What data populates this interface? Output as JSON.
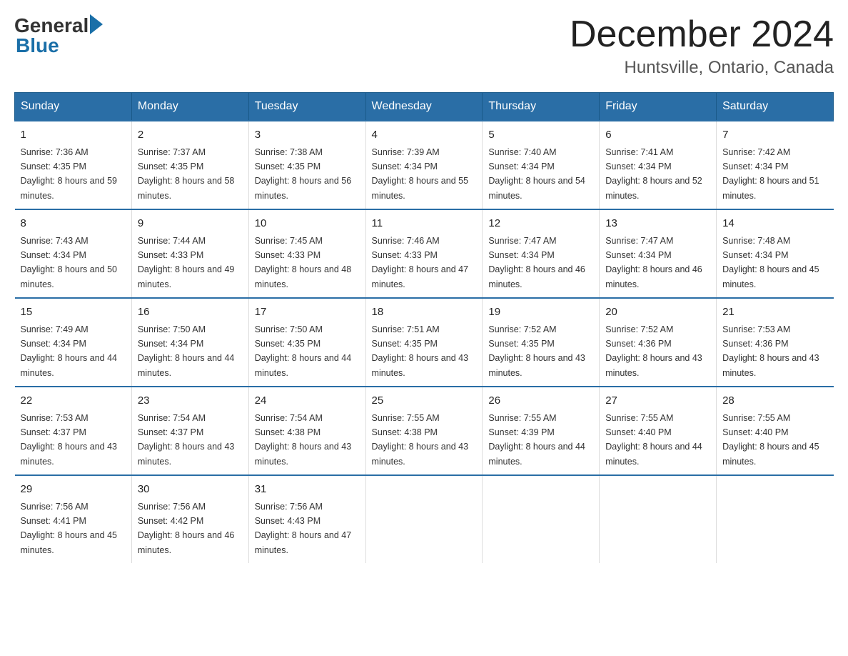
{
  "header": {
    "logo_general": "General",
    "logo_blue": "Blue",
    "title": "December 2024",
    "location": "Huntsville, Ontario, Canada"
  },
  "days_of_week": [
    "Sunday",
    "Monday",
    "Tuesday",
    "Wednesday",
    "Thursday",
    "Friday",
    "Saturday"
  ],
  "weeks": [
    [
      {
        "day": "1",
        "sunrise": "7:36 AM",
        "sunset": "4:35 PM",
        "daylight": "8 hours and 59 minutes."
      },
      {
        "day": "2",
        "sunrise": "7:37 AM",
        "sunset": "4:35 PM",
        "daylight": "8 hours and 58 minutes."
      },
      {
        "day": "3",
        "sunrise": "7:38 AM",
        "sunset": "4:35 PM",
        "daylight": "8 hours and 56 minutes."
      },
      {
        "day": "4",
        "sunrise": "7:39 AM",
        "sunset": "4:34 PM",
        "daylight": "8 hours and 55 minutes."
      },
      {
        "day": "5",
        "sunrise": "7:40 AM",
        "sunset": "4:34 PM",
        "daylight": "8 hours and 54 minutes."
      },
      {
        "day": "6",
        "sunrise": "7:41 AM",
        "sunset": "4:34 PM",
        "daylight": "8 hours and 52 minutes."
      },
      {
        "day": "7",
        "sunrise": "7:42 AM",
        "sunset": "4:34 PM",
        "daylight": "8 hours and 51 minutes."
      }
    ],
    [
      {
        "day": "8",
        "sunrise": "7:43 AM",
        "sunset": "4:34 PM",
        "daylight": "8 hours and 50 minutes."
      },
      {
        "day": "9",
        "sunrise": "7:44 AM",
        "sunset": "4:33 PM",
        "daylight": "8 hours and 49 minutes."
      },
      {
        "day": "10",
        "sunrise": "7:45 AM",
        "sunset": "4:33 PM",
        "daylight": "8 hours and 48 minutes."
      },
      {
        "day": "11",
        "sunrise": "7:46 AM",
        "sunset": "4:33 PM",
        "daylight": "8 hours and 47 minutes."
      },
      {
        "day": "12",
        "sunrise": "7:47 AM",
        "sunset": "4:34 PM",
        "daylight": "8 hours and 46 minutes."
      },
      {
        "day": "13",
        "sunrise": "7:47 AM",
        "sunset": "4:34 PM",
        "daylight": "8 hours and 46 minutes."
      },
      {
        "day": "14",
        "sunrise": "7:48 AM",
        "sunset": "4:34 PM",
        "daylight": "8 hours and 45 minutes."
      }
    ],
    [
      {
        "day": "15",
        "sunrise": "7:49 AM",
        "sunset": "4:34 PM",
        "daylight": "8 hours and 44 minutes."
      },
      {
        "day": "16",
        "sunrise": "7:50 AM",
        "sunset": "4:34 PM",
        "daylight": "8 hours and 44 minutes."
      },
      {
        "day": "17",
        "sunrise": "7:50 AM",
        "sunset": "4:35 PM",
        "daylight": "8 hours and 44 minutes."
      },
      {
        "day": "18",
        "sunrise": "7:51 AM",
        "sunset": "4:35 PM",
        "daylight": "8 hours and 43 minutes."
      },
      {
        "day": "19",
        "sunrise": "7:52 AM",
        "sunset": "4:35 PM",
        "daylight": "8 hours and 43 minutes."
      },
      {
        "day": "20",
        "sunrise": "7:52 AM",
        "sunset": "4:36 PM",
        "daylight": "8 hours and 43 minutes."
      },
      {
        "day": "21",
        "sunrise": "7:53 AM",
        "sunset": "4:36 PM",
        "daylight": "8 hours and 43 minutes."
      }
    ],
    [
      {
        "day": "22",
        "sunrise": "7:53 AM",
        "sunset": "4:37 PM",
        "daylight": "8 hours and 43 minutes."
      },
      {
        "day": "23",
        "sunrise": "7:54 AM",
        "sunset": "4:37 PM",
        "daylight": "8 hours and 43 minutes."
      },
      {
        "day": "24",
        "sunrise": "7:54 AM",
        "sunset": "4:38 PM",
        "daylight": "8 hours and 43 minutes."
      },
      {
        "day": "25",
        "sunrise": "7:55 AM",
        "sunset": "4:38 PM",
        "daylight": "8 hours and 43 minutes."
      },
      {
        "day": "26",
        "sunrise": "7:55 AM",
        "sunset": "4:39 PM",
        "daylight": "8 hours and 44 minutes."
      },
      {
        "day": "27",
        "sunrise": "7:55 AM",
        "sunset": "4:40 PM",
        "daylight": "8 hours and 44 minutes."
      },
      {
        "day": "28",
        "sunrise": "7:55 AM",
        "sunset": "4:40 PM",
        "daylight": "8 hours and 45 minutes."
      }
    ],
    [
      {
        "day": "29",
        "sunrise": "7:56 AM",
        "sunset": "4:41 PM",
        "daylight": "8 hours and 45 minutes."
      },
      {
        "day": "30",
        "sunrise": "7:56 AM",
        "sunset": "4:42 PM",
        "daylight": "8 hours and 46 minutes."
      },
      {
        "day": "31",
        "sunrise": "7:56 AM",
        "sunset": "4:43 PM",
        "daylight": "8 hours and 47 minutes."
      },
      null,
      null,
      null,
      null
    ]
  ]
}
